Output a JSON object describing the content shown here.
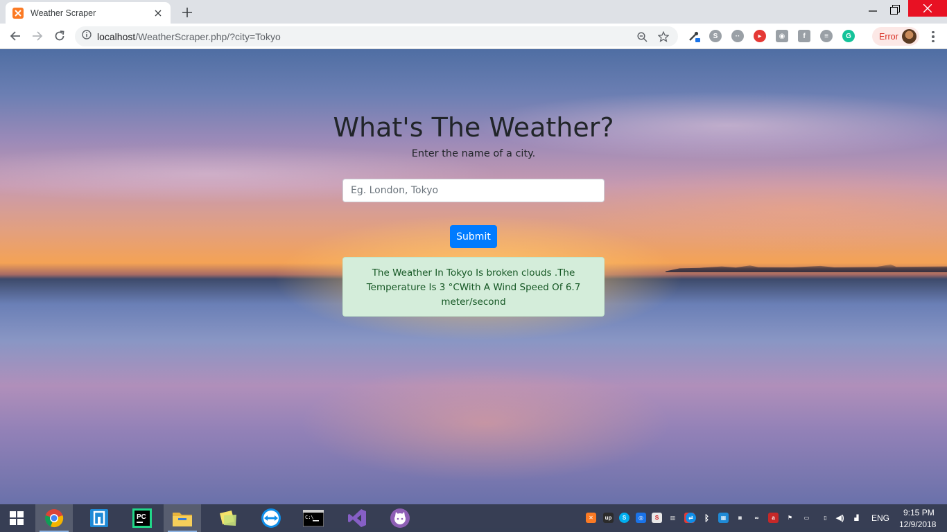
{
  "browser": {
    "tab_title": "Weather Scraper",
    "url_host": "localhost",
    "url_path": "/WeatherScraper.php/?city=Tokyo",
    "error_label": "Error"
  },
  "page": {
    "heading": "What's The Weather?",
    "subtitle": "Enter the name of a city.",
    "input_placeholder": "Eg. London, Tokyo",
    "input_value": "",
    "submit_label": "Submit",
    "result_text": "The Weather In Tokyo Is broken clouds .The Temperature Is 3 °CWith A Wind Speed Of 6.7 meter/second"
  },
  "taskbar": {
    "apps": [
      "Chrome",
      "Remote Desktop",
      "PyCharm",
      "File Explorer",
      "Sticky Notes",
      "TeamViewer",
      "Command Prompt",
      "Visual Studio",
      "GitHub Desktop"
    ],
    "language": "ENG",
    "time": "9:15 PM",
    "date": "12/9/2018"
  },
  "colors": {
    "accent": "#007bff",
    "alert_bg": "#d4edda",
    "alert_text": "#155724",
    "error_chip": "#d93025"
  }
}
